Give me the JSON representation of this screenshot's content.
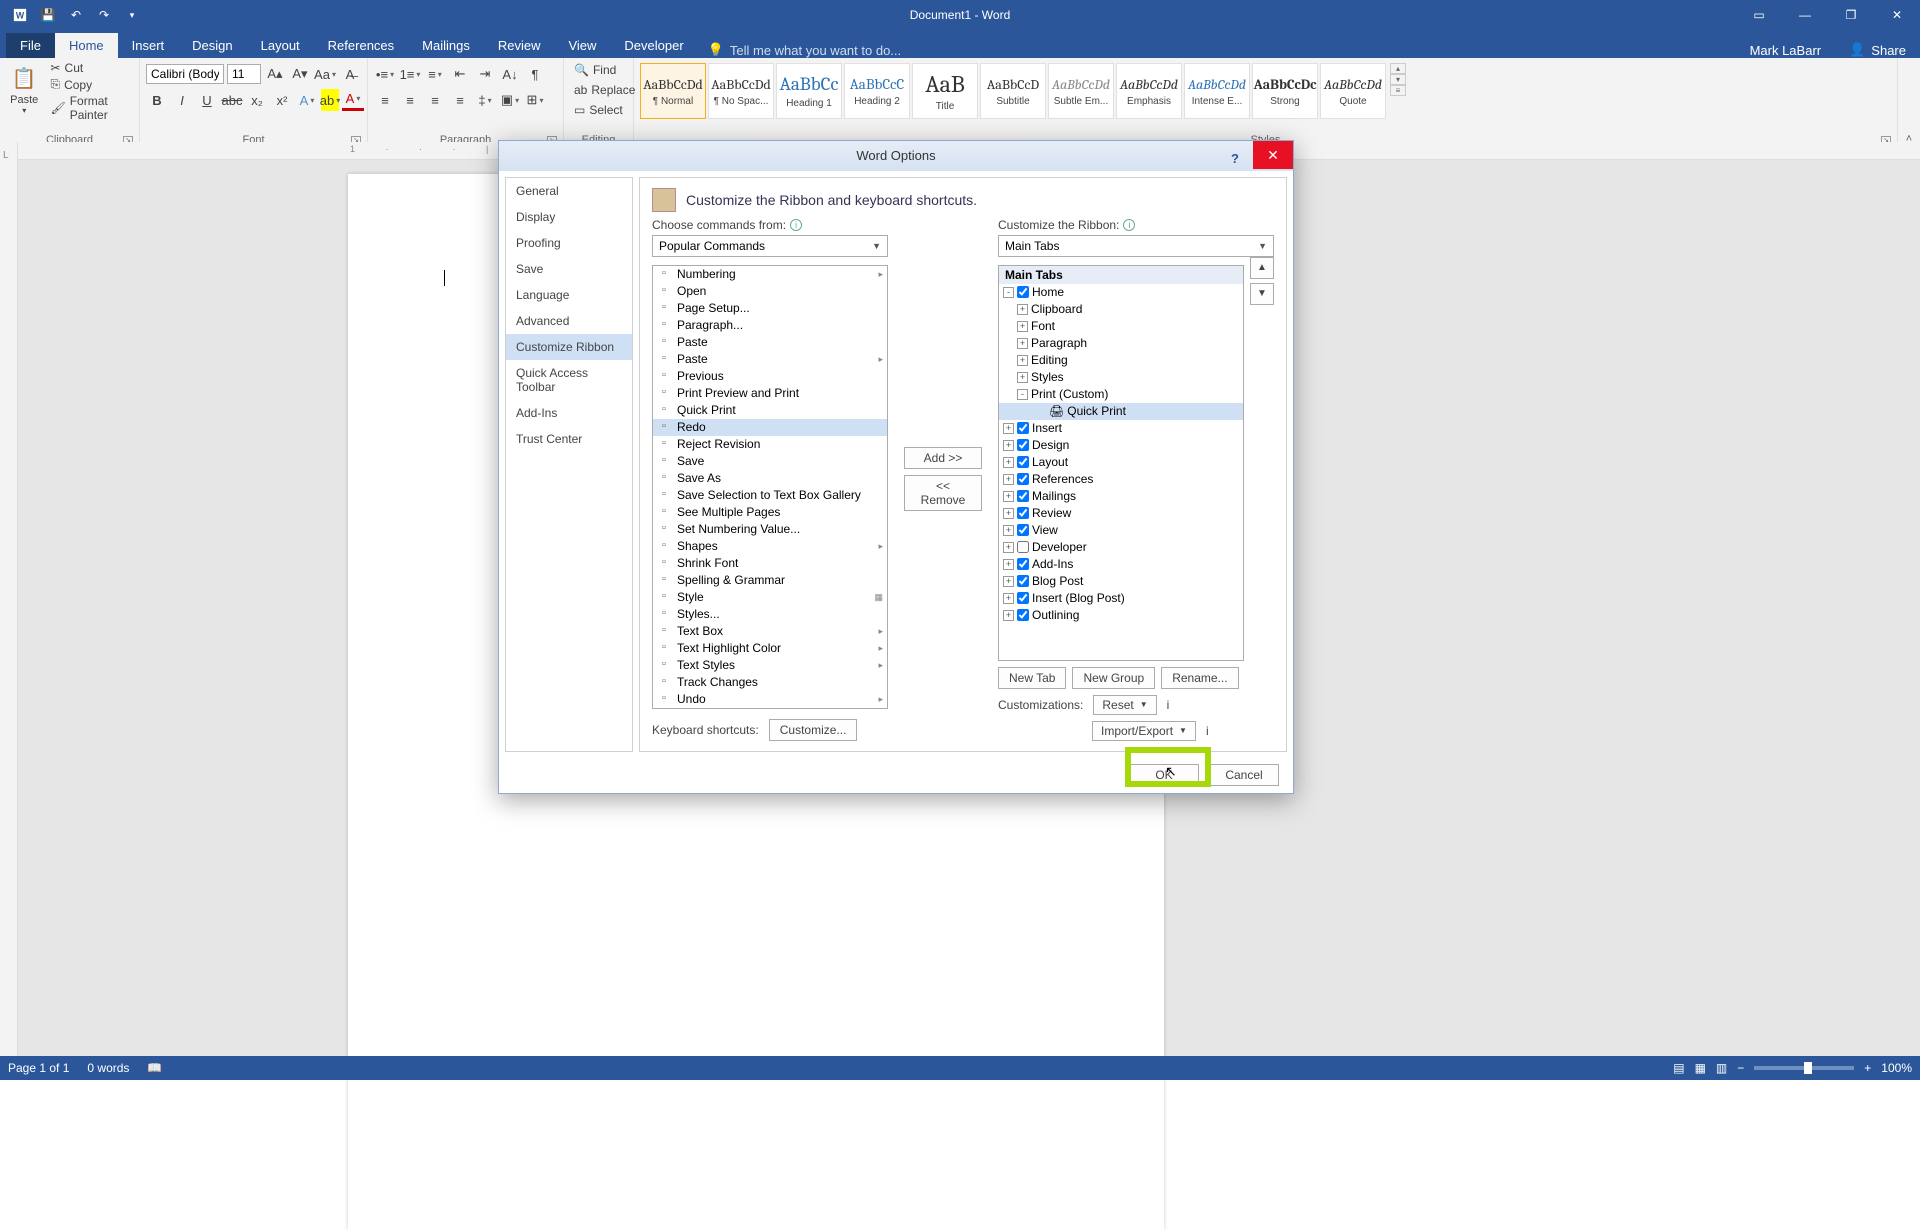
{
  "titlebar": {
    "doc": "Document1 - Word"
  },
  "user": {
    "name": "Mark LaBarr",
    "share": "Share"
  },
  "tabs": [
    "File",
    "Home",
    "Insert",
    "Design",
    "Layout",
    "References",
    "Mailings",
    "Review",
    "View",
    "Developer"
  ],
  "tellme": "Tell me what you want to do...",
  "clipboard": {
    "paste": "Paste",
    "cut": "Cut",
    "copy": "Copy",
    "format_painter": "Format Painter",
    "label": "Clipboard"
  },
  "font": {
    "name": "Calibri (Body)",
    "size": "11",
    "label": "Font"
  },
  "paragraph": {
    "label": "Paragraph"
  },
  "editing": {
    "find": "Find",
    "replace": "Replace",
    "select": "Select",
    "label": "Editing"
  },
  "styles_label": "Styles",
  "styles": [
    {
      "name": "¶ Normal",
      "prev": "AaBbCcDd",
      "cls": "sel"
    },
    {
      "name": "¶ No Spac...",
      "prev": "AaBbCcDd",
      "cls": ""
    },
    {
      "name": "Heading 1",
      "prev": "AaBbCc",
      "cls": "h1"
    },
    {
      "name": "Heading 2",
      "prev": "AaBbCcC",
      "cls": "h2"
    },
    {
      "name": "Title",
      "prev": "AaB",
      "cls": "title"
    },
    {
      "name": "Subtitle",
      "prev": "AaBbCcD",
      "cls": ""
    },
    {
      "name": "Subtle Em...",
      "prev": "AaBbCcDd",
      "cls": "subtle"
    },
    {
      "name": "Emphasis",
      "prev": "AaBbCcDd",
      "cls": "emph"
    },
    {
      "name": "Intense E...",
      "prev": "AaBbCcDd",
      "cls": "intense"
    },
    {
      "name": "Strong",
      "prev": "AaBbCcDc",
      "cls": "strong"
    },
    {
      "name": "Quote",
      "prev": "AaBbCcDd",
      "cls": "quote"
    }
  ],
  "status": {
    "page": "Page 1 of 1",
    "words": "0 words",
    "zoom": "100%"
  },
  "dialog": {
    "title": "Word Options",
    "heading": "Customize the Ribbon and keyboard shortcuts.",
    "nav": [
      "General",
      "Display",
      "Proofing",
      "Save",
      "Language",
      "Advanced",
      "Customize Ribbon",
      "Quick Access Toolbar",
      "Add-Ins",
      "Trust Center"
    ],
    "nav_sel": "Customize Ribbon",
    "choose_lbl": "Choose commands from:",
    "choose_val": "Popular Commands",
    "custom_lbl": "Customize the Ribbon:",
    "custom_val": "Main Tabs",
    "tree_head": "Main Tabs",
    "add": "Add >>",
    "remove": "<< Remove",
    "new_tab": "New Tab",
    "new_group": "New Group",
    "rename": "Rename...",
    "customizations": "Customizations:",
    "reset": "Reset",
    "import_export": "Import/Export",
    "kb_lbl": "Keyboard shortcuts:",
    "customize": "Customize...",
    "ok": "OK",
    "cancel": "Cancel",
    "commands": [
      {
        "t": "Numbering",
        "sub": "▸"
      },
      {
        "t": "Open"
      },
      {
        "t": "Page Setup..."
      },
      {
        "t": "Paragraph..."
      },
      {
        "t": "Paste"
      },
      {
        "t": "Paste",
        "sub": "▸"
      },
      {
        "t": "Previous"
      },
      {
        "t": "Print Preview and Print"
      },
      {
        "t": "Quick Print"
      },
      {
        "t": "Redo",
        "sel": true
      },
      {
        "t": "Reject Revision"
      },
      {
        "t": "Save"
      },
      {
        "t": "Save As"
      },
      {
        "t": "Save Selection to Text Box Gallery"
      },
      {
        "t": "See Multiple Pages"
      },
      {
        "t": "Set Numbering Value..."
      },
      {
        "t": "Shapes",
        "sub": "▸"
      },
      {
        "t": "Shrink Font"
      },
      {
        "t": "Spelling & Grammar"
      },
      {
        "t": "Style",
        "sub": "▦"
      },
      {
        "t": "Styles..."
      },
      {
        "t": "Text Box",
        "sub": "▸"
      },
      {
        "t": "Text Highlight Color",
        "sub": "▸"
      },
      {
        "t": "Text Styles",
        "sub": "▸"
      },
      {
        "t": "Track Changes"
      },
      {
        "t": "Undo",
        "sub": "▸"
      }
    ],
    "tree": [
      {
        "d": 0,
        "exp": "-",
        "chk": true,
        "t": "Home"
      },
      {
        "d": 1,
        "exp": "+",
        "t": "Clipboard"
      },
      {
        "d": 1,
        "exp": "+",
        "t": "Font"
      },
      {
        "d": 1,
        "exp": "+",
        "t": "Paragraph"
      },
      {
        "d": 1,
        "exp": "+",
        "t": "Editing"
      },
      {
        "d": 1,
        "exp": "+",
        "t": "Styles"
      },
      {
        "d": 1,
        "exp": "-",
        "t": "Print (Custom)"
      },
      {
        "d": 2,
        "ic": "🖨",
        "t": "Quick Print",
        "sel": true
      },
      {
        "d": 0,
        "exp": "+",
        "chk": true,
        "t": "Insert"
      },
      {
        "d": 0,
        "exp": "+",
        "chk": true,
        "t": "Design"
      },
      {
        "d": 0,
        "exp": "+",
        "chk": true,
        "t": "Layout"
      },
      {
        "d": 0,
        "exp": "+",
        "chk": true,
        "t": "References"
      },
      {
        "d": 0,
        "exp": "+",
        "chk": true,
        "t": "Mailings"
      },
      {
        "d": 0,
        "exp": "+",
        "chk": true,
        "t": "Review"
      },
      {
        "d": 0,
        "exp": "+",
        "chk": true,
        "t": "View"
      },
      {
        "d": 0,
        "exp": "+",
        "chk": false,
        "t": "Developer"
      },
      {
        "d": 0,
        "exp": "+",
        "chk": true,
        "t": "Add-Ins"
      },
      {
        "d": 0,
        "exp": "+",
        "chk": true,
        "t": "Blog Post"
      },
      {
        "d": 0,
        "exp": "+",
        "chk": true,
        "t": "Insert (Blog Post)"
      },
      {
        "d": 0,
        "exp": "+",
        "chk": true,
        "t": "Outlining"
      }
    ]
  }
}
